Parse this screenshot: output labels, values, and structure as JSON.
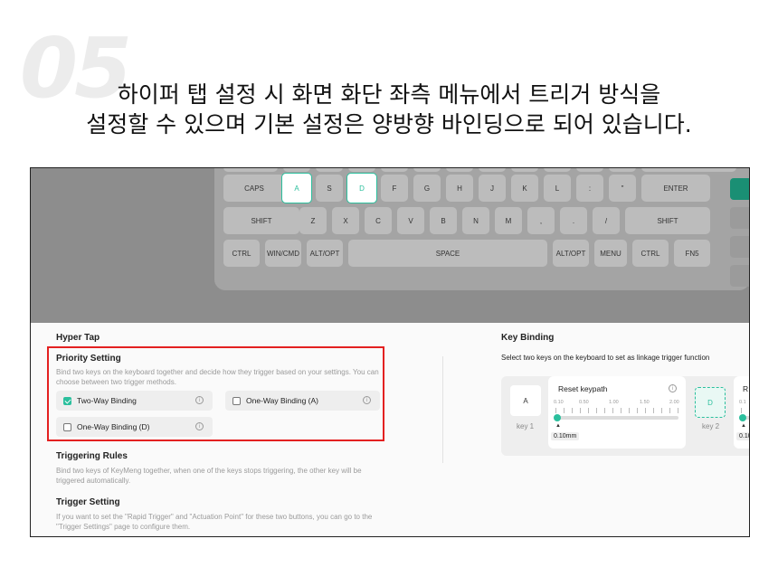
{
  "step_number": "05",
  "caption": {
    "line1": "하이퍼 탭 설정 시 화면 화단 좌측 메뉴에서 트리거 방식을",
    "line2": "설정할 수 있으며 기본 설정은 양방향 바인딩으로 되어 있습니다."
  },
  "keyboard": {
    "row_caps": [
      "CAPS",
      "A",
      "S",
      "D",
      "F",
      "G",
      "H",
      "J",
      "K",
      "L",
      ":",
      "\"",
      "ENTER"
    ],
    "row_shift": [
      "SHIFT",
      "Z",
      "X",
      "C",
      "V",
      "B",
      "N",
      "M",
      ",",
      ".",
      "/",
      "SHIFT"
    ],
    "row_bottom": [
      "CTRL",
      "WIN/CMD",
      "ALT/OPT",
      "SPACE",
      "ALT/OPT",
      "MENU",
      "CTRL",
      "FN5"
    ],
    "selected_keys": [
      "A",
      "D"
    ]
  },
  "hyper_tap": {
    "title": "Hyper Tap",
    "priority": {
      "title": "Priority Setting",
      "description": "Bind two keys on the keyboard together and decide how they trigger based on your settings. You can choose between two trigger methods.",
      "options": [
        {
          "label": "Two-Way Binding",
          "checked": true
        },
        {
          "label": "One-Way Binding (A)",
          "checked": false
        },
        {
          "label": "One-Way Binding (D)",
          "checked": false
        }
      ]
    },
    "rules": {
      "title": "Triggering Rules",
      "description": "Bind two keys of KeyMeng together, when one of the keys stops triggering, the other key will be triggered automatically."
    },
    "trigger": {
      "title": "Trigger Setting",
      "description": "If you want to set the \"Rapid Trigger\" and \"Actuation Point\" for these two buttons, you can go to the \"Trigger Settings\" page to configure them."
    }
  },
  "key_binding": {
    "title": "Key Binding",
    "subtitle": "Select two keys on the keyboard to set as linkage trigger function",
    "key1": {
      "key": "A",
      "label": "key 1",
      "reset": "Reset keypath",
      "value": "0.10mm"
    },
    "key2": {
      "key": "D",
      "label": "key 2",
      "reset": "R",
      "value": "0.10m"
    },
    "scale_ticks": [
      "0.10",
      "0.50",
      "1.00",
      "1.50",
      "2.00"
    ],
    "scale_ticks_partial": [
      "0.1"
    ]
  },
  "colors": {
    "accent": "#2bbf9d",
    "highlight_box": "#e32020",
    "overlay": "#8d8d8d"
  }
}
